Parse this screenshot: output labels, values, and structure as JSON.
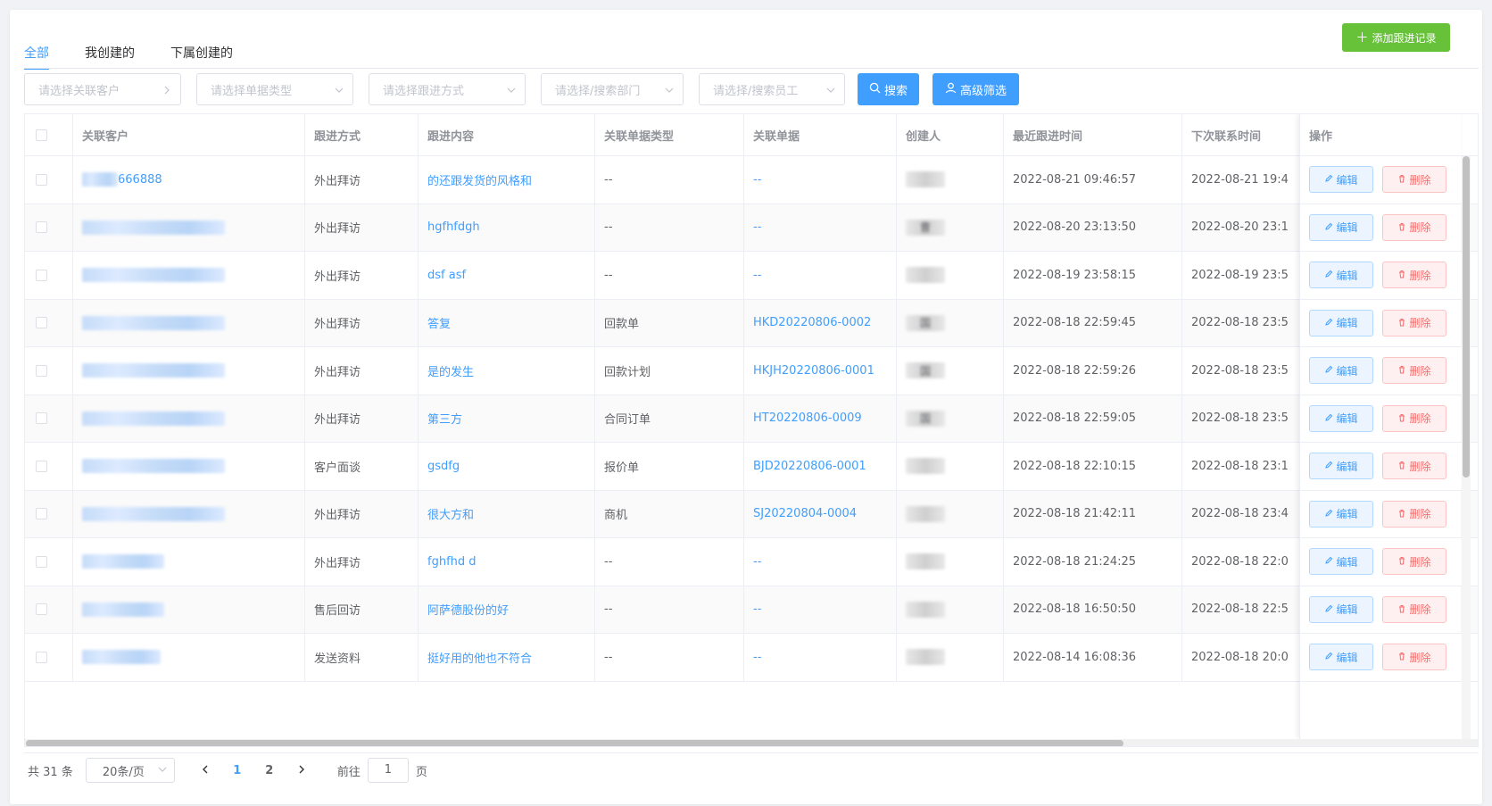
{
  "tabs": [
    {
      "label": "全部",
      "active": true
    },
    {
      "label": "我创建的",
      "active": false
    },
    {
      "label": "下属创建的",
      "active": false
    }
  ],
  "add_button": "添加跟进记录",
  "filters": {
    "customer": "请选择关联客户",
    "doc_type": "请选择单据类型",
    "method": "请选择跟进方式",
    "dept": "请选择/搜索部门",
    "employee": "请选择/搜索员工",
    "search": "搜索",
    "advanced": "高级筛选"
  },
  "columns": [
    "关联客户",
    "跟进方式",
    "跟进内容",
    "关联单据类型",
    "关联单据",
    "创建人",
    "最近跟进时间",
    "下次联系时间",
    "操作"
  ],
  "rows": [
    {
      "customer": "666888",
      "method": "外出拜访",
      "content": "的还跟发货的风格和",
      "doc_type": "--",
      "doc": "--",
      "creator": "",
      "last": "2022-08-21 09:46:57",
      "next": "2022-08-21 19:4"
    },
    {
      "customer": "",
      "method": "外出拜访",
      "content": "hgfhfdgh",
      "doc_type": "--",
      "doc": "--",
      "creator": "曹",
      "last": "2022-08-20 23:13:50",
      "next": "2022-08-20 23:1"
    },
    {
      "customer": "",
      "method": "外出拜访",
      "content": "dsf asf",
      "doc_type": "--",
      "doc": "--",
      "creator": "",
      "last": "2022-08-19 23:58:15",
      "next": "2022-08-19 23:5"
    },
    {
      "customer": "",
      "method": "外出拜访",
      "content": "答复",
      "doc_type": "回款单",
      "doc": "HKD20220806-0002",
      "creator": "国",
      "last": "2022-08-18 22:59:45",
      "next": "2022-08-18 23:5"
    },
    {
      "customer": "",
      "method": "外出拜访",
      "content": "是的发生",
      "doc_type": "回款计划",
      "doc": "HKJH20220806-0001",
      "creator": "国",
      "last": "2022-08-18 22:59:26",
      "next": "2022-08-18 23:5"
    },
    {
      "customer": "",
      "method": "外出拜访",
      "content": "第三方",
      "doc_type": "合同订单",
      "doc": "HT20220806-0009",
      "creator": "国",
      "last": "2022-08-18 22:59:05",
      "next": "2022-08-18 23:5"
    },
    {
      "customer": "",
      "method": "客户面谈",
      "content": "gsdfg",
      "doc_type": "报价单",
      "doc": "BJD20220806-0001",
      "creator": "",
      "last": "2022-08-18 22:10:15",
      "next": "2022-08-18 23:1"
    },
    {
      "customer": "",
      "method": "外出拜访",
      "content": "很大方和",
      "doc_type": "商机",
      "doc": "SJ20220804-0004",
      "creator": "",
      "last": "2022-08-18 21:42:11",
      "next": "2022-08-18 23:4"
    },
    {
      "customer": "",
      "method": "外出拜访",
      "content": "fghfhd d",
      "doc_type": "--",
      "doc": "--",
      "creator": "",
      "last": "2022-08-18 21:24:25",
      "next": "2022-08-18 22:0"
    },
    {
      "customer": "",
      "method": "售后回访",
      "content": "阿萨德股份的好",
      "doc_type": "--",
      "doc": "--",
      "creator": "",
      "last": "2022-08-18 16:50:50",
      "next": "2022-08-18 22:5"
    },
    {
      "customer": "",
      "method": "发送资料",
      "content": "挺好用的他也不符合",
      "doc_type": "--",
      "doc": "--",
      "creator": "",
      "last": "2022-08-14 16:08:36",
      "next": "2022-08-18 20:0"
    }
  ],
  "ops": {
    "edit": "编辑",
    "delete": "删除"
  },
  "pagination": {
    "total": "共 31 条",
    "size": "20条/页",
    "pages": [
      "1",
      "2"
    ],
    "current": "1",
    "goto_label": "前往",
    "goto_value": "1",
    "page_unit": "页"
  }
}
